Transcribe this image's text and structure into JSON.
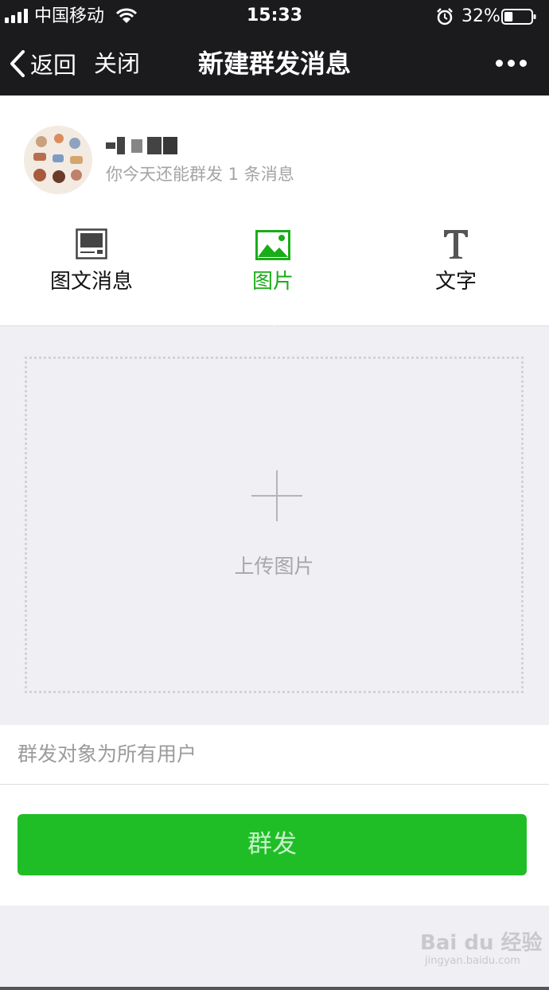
{
  "status_bar": {
    "carrier": "中国移动",
    "time": "15:33",
    "battery_percent": "32%",
    "battery_level": 0.32,
    "icons": [
      "signal-icon",
      "wifi-icon",
      "alarm-icon",
      "battery-icon"
    ]
  },
  "nav": {
    "back_label": "返回",
    "close_label": "关闭",
    "title": "新建群发消息",
    "more_icon": "more-dots-icon"
  },
  "account": {
    "quota_text": "你今天还能群发 1 条消息"
  },
  "tabs": [
    {
      "label": "图文消息",
      "icon": "article-icon",
      "active": false
    },
    {
      "label": "图片",
      "icon": "image-icon",
      "active": true
    },
    {
      "label": "文字",
      "icon": "text-icon",
      "active": false
    }
  ],
  "upload": {
    "label": "上传图片",
    "icon": "plus-icon"
  },
  "audience": {
    "label": "群发对象为所有用户"
  },
  "send": {
    "label": "群发"
  },
  "watermark": {
    "brand": "Bai du 经验",
    "url": "jingyan.baidu.com"
  },
  "colors": {
    "nav_bg": "#1b1b1d",
    "accent": "#1aad19",
    "button": "#1fbe26",
    "page_bg": "#efeff4"
  }
}
